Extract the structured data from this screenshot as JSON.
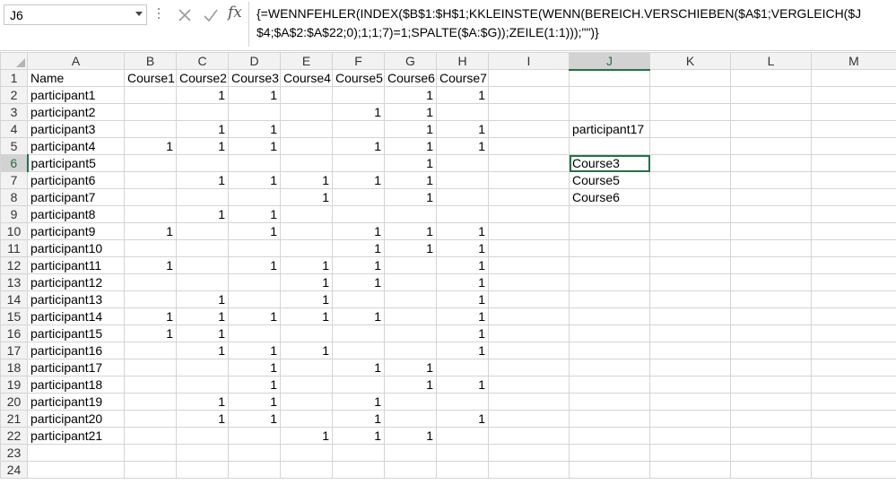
{
  "namebox": {
    "value": "J6"
  },
  "formula_bar": {
    "fx_label": "fx",
    "formula": "{=WENNFEHLER(INDEX($B$1:$H$1;KKLEINSTE(WENN(BEREICH.VERSCHIEBEN($A$1;VERGLEICH($J$4;$A$2:$A$22;0);1;1;7)=1;SPALTE($A:$G));ZEILE(1:1)));\"\")}"
  },
  "columns": [
    "A",
    "B",
    "C",
    "D",
    "E",
    "F",
    "G",
    "H",
    "I",
    "J",
    "K",
    "L",
    "M"
  ],
  "selected_column": "J",
  "selected_row": "6",
  "rows": [
    {
      "n": "1",
      "cells": [
        "Name",
        "Course1",
        "Course2",
        "Course3",
        "Course4",
        "Course5",
        "Course6",
        "Course7",
        "",
        "",
        "",
        "",
        ""
      ]
    },
    {
      "n": "2",
      "cells": [
        "participant1",
        "",
        "1",
        "1",
        "",
        "",
        "1",
        "1",
        "",
        "",
        "",
        "",
        ""
      ]
    },
    {
      "n": "3",
      "cells": [
        "participant2",
        "",
        "",
        "",
        "",
        "1",
        "1",
        "",
        "",
        "",
        "",
        "",
        ""
      ]
    },
    {
      "n": "4",
      "cells": [
        "participant3",
        "",
        "1",
        "1",
        "",
        "",
        "1",
        "1",
        "",
        "participant17",
        "",
        "",
        ""
      ]
    },
    {
      "n": "5",
      "cells": [
        "participant4",
        "1",
        "1",
        "1",
        "",
        "1",
        "1",
        "1",
        "",
        "",
        "",
        "",
        ""
      ]
    },
    {
      "n": "6",
      "cells": [
        "participant5",
        "",
        "",
        "",
        "",
        "",
        "1",
        "",
        "",
        "Course3",
        "",
        "",
        ""
      ]
    },
    {
      "n": "7",
      "cells": [
        "participant6",
        "",
        "1",
        "1",
        "1",
        "1",
        "1",
        "",
        "",
        "Course5",
        "",
        "",
        ""
      ]
    },
    {
      "n": "8",
      "cells": [
        "participant7",
        "",
        "",
        "",
        "1",
        "",
        "1",
        "",
        "",
        "Course6",
        "",
        "",
        ""
      ]
    },
    {
      "n": "9",
      "cells": [
        "participant8",
        "",
        "1",
        "1",
        "",
        "",
        "",
        "",
        "",
        "",
        "",
        "",
        ""
      ]
    },
    {
      "n": "10",
      "cells": [
        "participant9",
        "1",
        "",
        "1",
        "",
        "1",
        "1",
        "1",
        "",
        "",
        "",
        "",
        ""
      ]
    },
    {
      "n": "11",
      "cells": [
        "participant10",
        "",
        "",
        "",
        "",
        "1",
        "1",
        "1",
        "",
        "",
        "",
        "",
        ""
      ]
    },
    {
      "n": "12",
      "cells": [
        "participant11",
        "1",
        "",
        "1",
        "1",
        "1",
        "",
        "1",
        "",
        "",
        "",
        "",
        ""
      ]
    },
    {
      "n": "13",
      "cells": [
        "participant12",
        "",
        "",
        "",
        "1",
        "1",
        "",
        "1",
        "",
        "",
        "",
        "",
        ""
      ]
    },
    {
      "n": "14",
      "cells": [
        "participant13",
        "",
        "1",
        "",
        "1",
        "",
        "",
        "1",
        "",
        "",
        "",
        "",
        ""
      ]
    },
    {
      "n": "15",
      "cells": [
        "participant14",
        "1",
        "1",
        "1",
        "1",
        "1",
        "",
        "1",
        "",
        "",
        "",
        "",
        ""
      ]
    },
    {
      "n": "16",
      "cells": [
        "participant15",
        "1",
        "1",
        "",
        "",
        "",
        "",
        "1",
        "",
        "",
        "",
        "",
        ""
      ]
    },
    {
      "n": "17",
      "cells": [
        "participant16",
        "",
        "1",
        "1",
        "1",
        "",
        "",
        "1",
        "",
        "",
        "",
        "",
        ""
      ]
    },
    {
      "n": "18",
      "cells": [
        "participant17",
        "",
        "",
        "1",
        "",
        "1",
        "1",
        "",
        "",
        "",
        "",
        "",
        ""
      ]
    },
    {
      "n": "19",
      "cells": [
        "participant18",
        "",
        "",
        "1",
        "",
        "",
        "1",
        "1",
        "",
        "",
        "",
        "",
        ""
      ]
    },
    {
      "n": "20",
      "cells": [
        "participant19",
        "",
        "1",
        "1",
        "",
        "1",
        "",
        "",
        "",
        "",
        "",
        "",
        ""
      ]
    },
    {
      "n": "21",
      "cells": [
        "participant20",
        "",
        "1",
        "1",
        "",
        "1",
        "",
        "1",
        "",
        "",
        "",
        "",
        ""
      ]
    },
    {
      "n": "22",
      "cells": [
        "participant21",
        "",
        "",
        "",
        "1",
        "1",
        "1",
        "",
        "",
        "",
        "",
        "",
        ""
      ]
    },
    {
      "n": "23",
      "cells": [
        "",
        "",
        "",
        "",
        "",
        "",
        "",
        "",
        "",
        "",
        "",
        "",
        ""
      ]
    },
    {
      "n": "24",
      "cells": [
        "",
        "",
        "",
        "",
        "",
        "",
        "",
        "",
        "",
        "",
        "",
        "",
        ""
      ]
    }
  ]
}
